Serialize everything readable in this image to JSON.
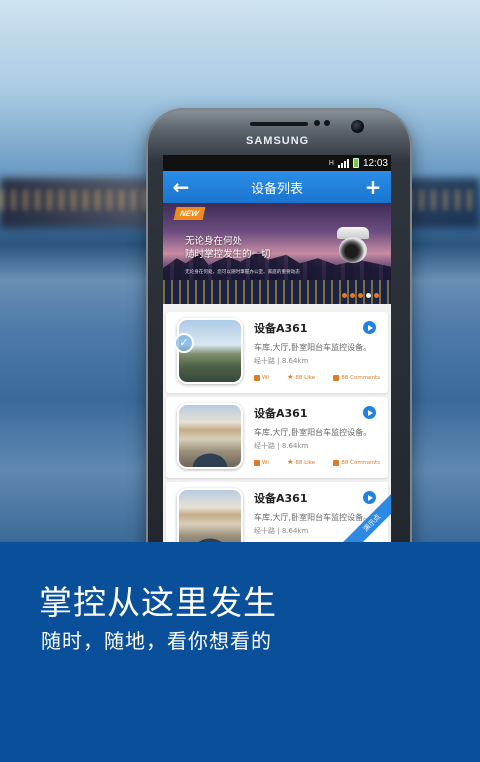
{
  "status_bar": {
    "network": "H",
    "time": "12:03"
  },
  "phone": {
    "brand": "SAMSUNG"
  },
  "app": {
    "title": "设备列表",
    "back_icon": "arrow-left-icon",
    "add_icon": "plus-icon"
  },
  "banner": {
    "badge": "NEW",
    "headline_line1": "无论身在何处",
    "headline_line2": "随时掌控发生的一切",
    "subline": "无论身在何处，您可以随时掌握办公室、家庭的重要动态",
    "page_count": 5,
    "active_page": 4
  },
  "devices": [
    {
      "name": "设备A361",
      "location": "车库,大厅,卧室阳台车监控设备。",
      "road": "经十路",
      "distance": "8.64km",
      "wifi_label": "Wi",
      "likes": "88 Like",
      "comments": "88 Comments",
      "selected": true
    },
    {
      "name": "设备A361",
      "location": "车库,大厅,卧室阳台车监控设备。",
      "road": "经十路",
      "distance": "8.64km",
      "wifi_label": "Wi",
      "likes": "88 Like",
      "comments": "88 Comments",
      "selected": false
    },
    {
      "name": "设备A361",
      "location": "车库,大厅,卧室阳台车监控设备。",
      "road": "经十路",
      "distance": "8.64km",
      "selected": false
    }
  ],
  "demo_ribbon": "演示点",
  "footer": {
    "heading": "掌控从这里发生",
    "subheading": "随时，随地，看你想看的"
  },
  "colors": {
    "accent_blue": "#1a74cf",
    "orange": "#e07a26",
    "footer_blue": "#0a4f9a"
  }
}
